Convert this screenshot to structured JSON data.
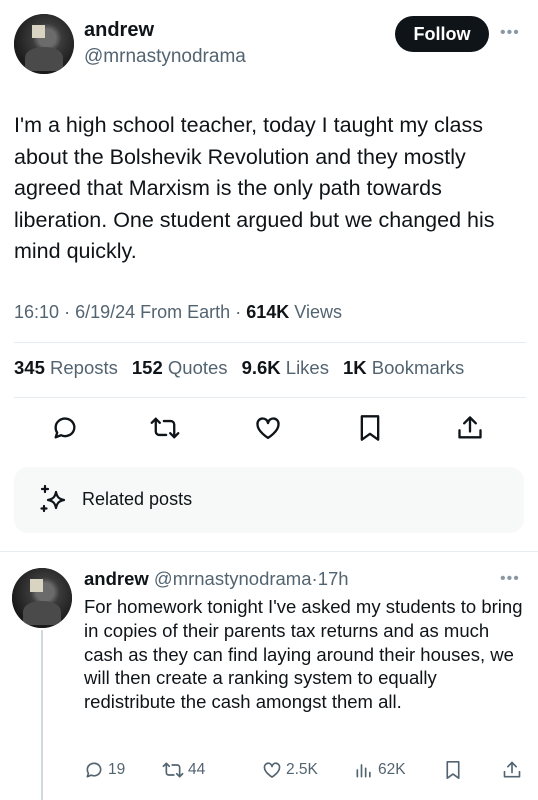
{
  "author": {
    "name": "andrew",
    "handle": "@mrnastynodrama",
    "follow_label": "Follow",
    "more_label": "•••"
  },
  "tweet": {
    "text": "I'm a high school teacher, today I taught my class about the Bolshevik Revolution and they mostly agreed that Marxism is the only path towards liberation. One student argued but we changed his mind quickly.",
    "time": "16:10",
    "date": "6/19/24",
    "source": "From Earth",
    "views_count": "614K",
    "views_label": "Views",
    "separator": "·"
  },
  "stats": [
    {
      "count": "345",
      "label": "Reposts"
    },
    {
      "count": "152",
      "label": "Quotes"
    },
    {
      "count": "9.6K",
      "label": "Likes"
    },
    {
      "count": "1K",
      "label": "Bookmarks"
    }
  ],
  "actions": [
    "reply-icon",
    "repost-icon",
    "like-icon",
    "bookmark-icon",
    "share-icon"
  ],
  "related": {
    "label": "Related posts",
    "icon": "sparkle-icon"
  },
  "reply": {
    "name": "andrew",
    "handle": "@mrnastynodrama",
    "separator": "·",
    "age": "17h",
    "more_label": "•••",
    "text": "For homework tonight I've asked my students to bring in copies of their parents tax returns and as much cash as they can find laying around their houses, we will then create a ranking system to equally redistribute the cash amongst them all.",
    "reply_count": "19",
    "repost_count": "44",
    "like_count": "2.5K",
    "views_count": "62K"
  },
  "colors": {
    "text": "#0f1419",
    "secondary": "#536471",
    "divider": "#e6ecf0",
    "related_bg": "#f7f9f9"
  }
}
